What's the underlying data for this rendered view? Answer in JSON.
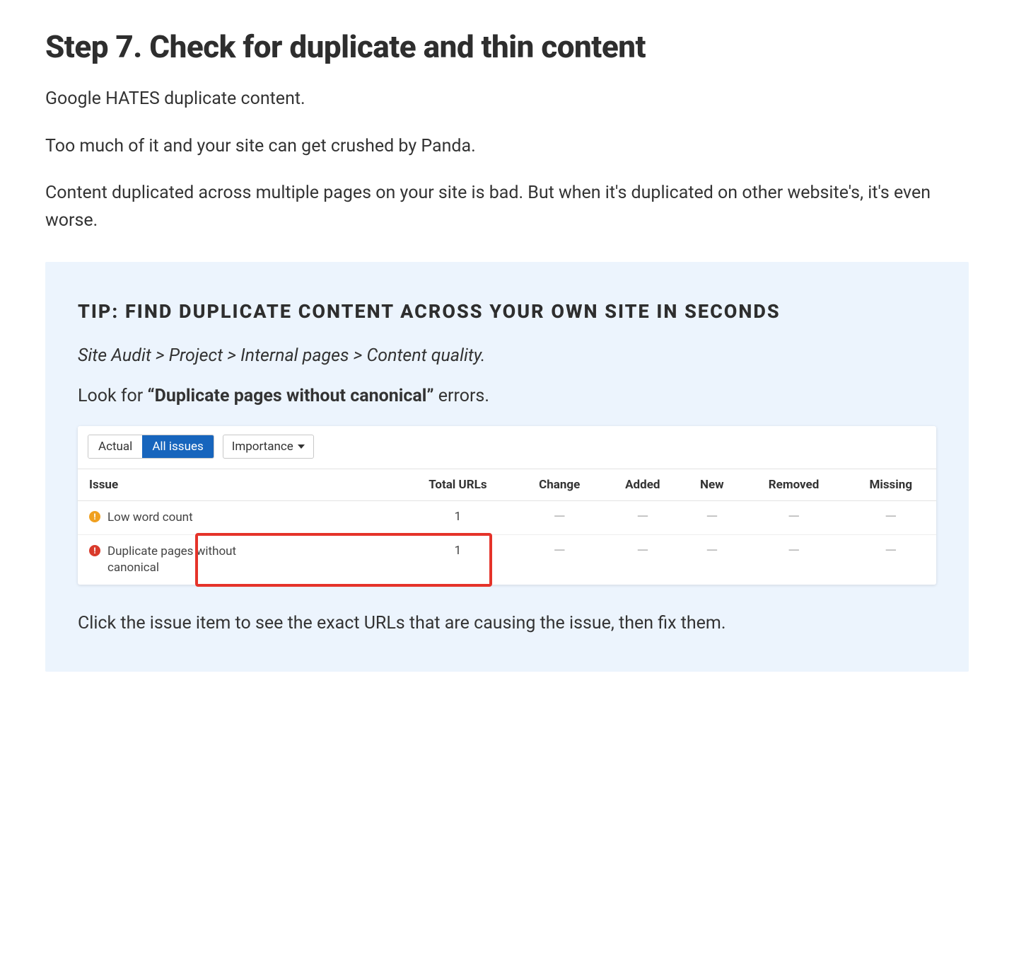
{
  "heading": "Step 7. Check for duplicate and thin content",
  "paragraphs": [
    "Google HATES duplicate content.",
    "Too much of it and your site can get crushed by Panda.",
    "Content duplicated across multiple pages on your site is bad. But when it's duplicated on other website's, it's even worse."
  ],
  "tip": {
    "heading": "TIP: FIND DUPLICATE CONTENT ACROSS YOUR OWN SITE IN SECONDS",
    "breadcrumb": "Site Audit > Project > Internal pages > Content quality.",
    "lookfor_prefix": "Look for ",
    "lookfor_bold": "“Duplicate pages without canonical”",
    "lookfor_suffix": " errors.",
    "followup": "Click the issue item to see the exact URLs that are causing the issue, then fix them."
  },
  "audit": {
    "tabs": {
      "actual": "Actual",
      "all_issues": "All issues"
    },
    "dropdown_label": "Importance",
    "columns": {
      "issue": "Issue",
      "total_urls": "Total URLs",
      "change": "Change",
      "added": "Added",
      "new": "New",
      "removed": "Removed",
      "missing": "Missing"
    },
    "rows": [
      {
        "severity": "warning",
        "icon_glyph": "!",
        "label": "Low word count",
        "total_urls": "1",
        "change": "—",
        "added": "—",
        "new": "—",
        "removed": "—",
        "missing": "—",
        "highlighted": false
      },
      {
        "severity": "error",
        "icon_glyph": "!",
        "label": "Duplicate pages without canonical",
        "total_urls": "1",
        "change": "—",
        "added": "—",
        "new": "—",
        "removed": "—",
        "missing": "—",
        "highlighted": true
      }
    ]
  }
}
